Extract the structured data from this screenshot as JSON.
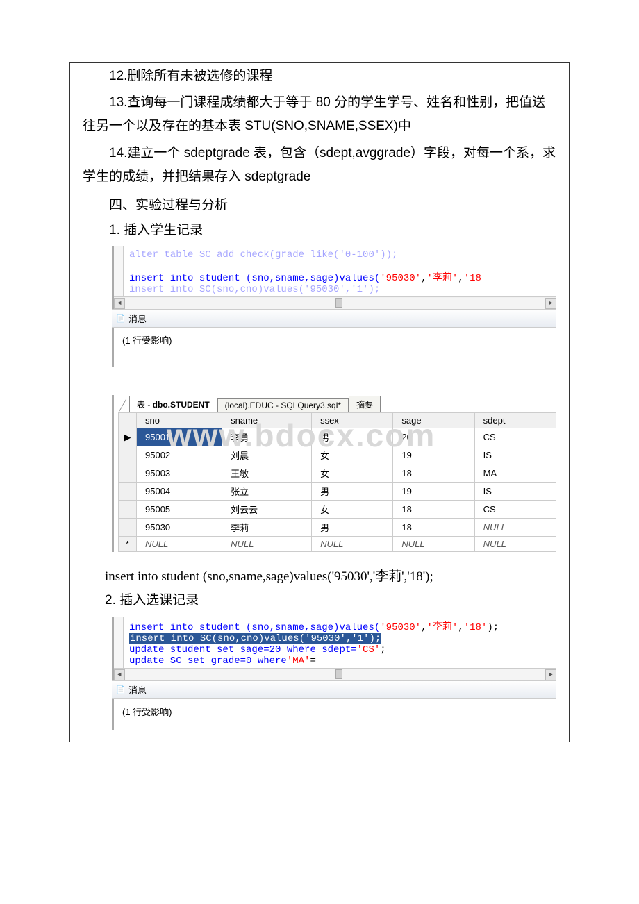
{
  "paragraphs": {
    "p12": "12.删除所有未被选修的课程",
    "p13": "13.查询每一门课程成绩都大于等于 80 分的学生学号、姓名和性别，把值送往另一个以及存在的基本表 STU(SNO,SNAME,SSEX)中",
    "p14": "14.建立一个 sdeptgrade 表，包含（sdept,avggrade）字段，对每一个系，求学生的成绩，并把结果存入 sdeptgrade",
    "section4": "四、实验过程与分析",
    "h1": "1. 插入学生记录",
    "codeline1": "insert into student (sno,sname,sage)values('95030','李莉','18');",
    "h2": "2. 插入选课记录"
  },
  "sql_block1": {
    "faded_top": "alter table SC add check(grade like('0-100'));",
    "line2_plain": "insert into student (sno,sname,sage)values(",
    "line2_str1": "'95030'",
    "line2_str2": "'李莉'",
    "line2_str3": "'18",
    "faded_line3": "insert into SC(sno,cno)values('95030','1');"
  },
  "messages_tab": "消息",
  "msg1": "(1 行受影响)",
  "tabs2": {
    "t1a": "表 - ",
    "t1b": "dbo.STUDENT",
    "t2": "(local).EDUC - SQLQuery3.sql*",
    "t3": "摘要"
  },
  "columns": [
    "sno",
    "sname",
    "ssex",
    "sage",
    "sdept"
  ],
  "rows": [
    {
      "sno": "95001",
      "sname": "李勇",
      "ssex": "男",
      "sage": "20",
      "sdept": "CS",
      "sel": true
    },
    {
      "sno": "95002",
      "sname": "刘晨",
      "ssex": "女",
      "sage": "19",
      "sdept": "IS"
    },
    {
      "sno": "95003",
      "sname": "王敏",
      "ssex": "女",
      "sage": "18",
      "sdept": "MA"
    },
    {
      "sno": "95004",
      "sname": "张立",
      "ssex": "男",
      "sage": "19",
      "sdept": "IS"
    },
    {
      "sno": "95005",
      "sname": "刘云云",
      "ssex": "女",
      "sage": "18",
      "sdept": "CS"
    },
    {
      "sno": "95030",
      "sname": "李莉",
      "ssex": "男",
      "sage": "18",
      "sdept": "NULL",
      "sdept_null": true
    }
  ],
  "null_row_label": "NULL",
  "watermark": "www.bdocx.com",
  "sql_block2": {
    "l1_a": "insert into student (sno,sname,sage)values(",
    "l1_s1": "'95030'",
    "l1_s2": "'李莉'",
    "l1_s3": "'18'",
    "l1_end": ");",
    "l2": "insert into SC(sno,cno)values('95030','1');",
    "l3_a": "update student set sage=20 where sdept=",
    "l3_s": "'CS'",
    "l3_end": ";",
    "l4_a": "update SC set grade=0 where",
    "l4_s": "'MA'",
    "l4_end": "="
  }
}
